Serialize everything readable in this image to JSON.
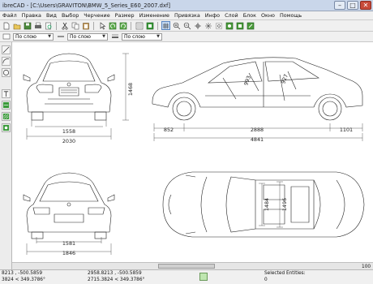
{
  "window": {
    "title": "ibreCAD - [C:\\Users\\GRAVITON\\BMW_5_Series_E60_2007.dxf]",
    "minimize": "–",
    "maximize": "□",
    "close": "✕"
  },
  "menu": [
    "Файл",
    "Правка",
    "Вид",
    "Выбор",
    "Черчение",
    "Размер",
    "Изменение",
    "Привязка",
    "Инфо",
    "Слой",
    "Блок",
    "Окно",
    "Помощь"
  ],
  "toolbar": {
    "icons": [
      "new-file",
      "open-file",
      "save-file",
      "print",
      "print-preview",
      "cut",
      "copy",
      "paste",
      "pointer",
      "undo",
      "redo",
      "layer-list",
      "block-list",
      "snap-grid",
      "zoom-in",
      "zoom-out",
      "zoom-auto",
      "zoom-previous",
      "zoom-window",
      "zoom-pan",
      "zoom-redraw",
      "zoom-scale"
    ]
  },
  "layer_toolbar": {
    "color_value": "По слою",
    "linetype_value": "По слою",
    "width_value": "По слою"
  },
  "drawing": {
    "front_width_top": "1558",
    "front_width_bottom": "2030",
    "front_height": "1468",
    "side_front_overhang": "852",
    "side_wheelbase": "2888",
    "side_rear_overhang": "1101",
    "side_total_length": "4841",
    "side_dim_a": "993",
    "side_dim_b": "927",
    "rear_track": "1581",
    "rear_width": "1846",
    "top_dim_a": "1484",
    "top_dim_b": "1496"
  },
  "status": {
    "coord_abs_1": "8213 , -500.5859",
    "coord_abs_2": "3824 < 349.3786°",
    "coord_rel_1": "2958.8213 , -500.5859",
    "coord_rel_2": "2715.3824 < 349.3786°",
    "selected_label": "Selected Entities:",
    "selected_count": "0",
    "zoom": "100"
  }
}
